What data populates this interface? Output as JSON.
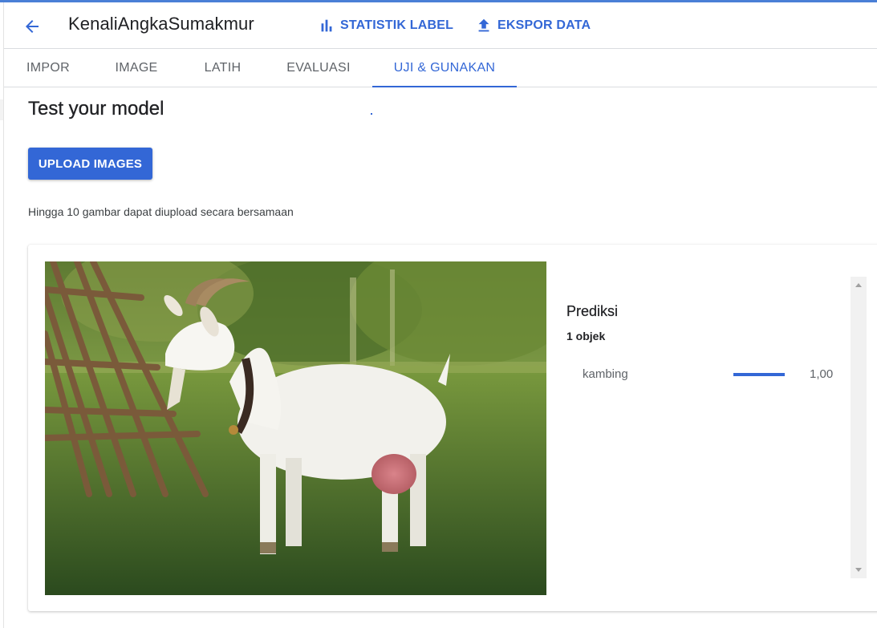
{
  "header": {
    "title": "KenaliAngkaSumakmur",
    "back_icon": "arrow-back-icon",
    "stats_label": "STATISTIK LABEL",
    "stats_icon": "bar-chart-icon",
    "export_label": "EKSPOR DATA",
    "export_icon": "upload-icon"
  },
  "tabs": [
    {
      "label": "IMPOR"
    },
    {
      "label": "IMAGE"
    },
    {
      "label": "LATIH"
    },
    {
      "label": "EVALUASI"
    },
    {
      "label": "UJI & GUNAKAN",
      "active": true
    }
  ],
  "main": {
    "title": "Test your model",
    "upload_label": "UPLOAD IMAGES",
    "upload_note": "Hingga 10 gambar dapat diupload secara bersamaan"
  },
  "prediction": {
    "image_subject": "white goat standing on grass next to wooden poles",
    "title": "Prediksi",
    "count_label": "1 objek",
    "items": [
      {
        "label": "kambing",
        "score": "1,00",
        "fraction": 1.0
      }
    ]
  },
  "colors": {
    "accent": "#3367d6",
    "text_primary": "#202124",
    "text_secondary": "#5f6368"
  }
}
